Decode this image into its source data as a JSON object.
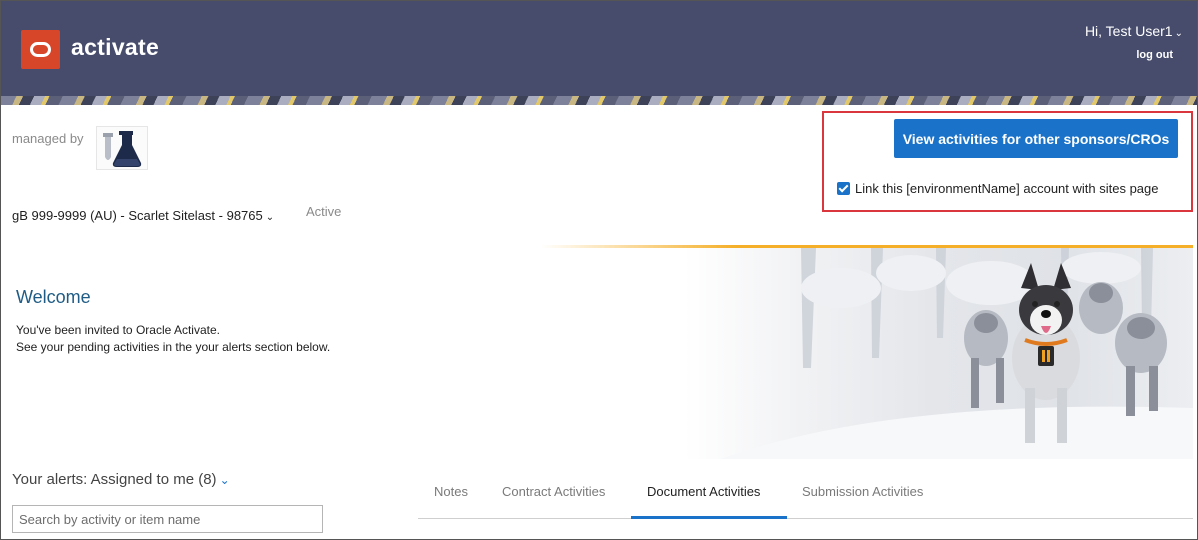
{
  "header": {
    "app_name": "activate",
    "greeting": "Hi, Test User1",
    "logout": "log out",
    "logo_color": "#d8462a",
    "bar_color": "#474c6c"
  },
  "sponsor": {
    "managed_by_label": "managed by",
    "logo_icon": "lab-flask-icon"
  },
  "site": {
    "selected": "gB 999-9999 (AU) - Scarlet Sitelast - 98765",
    "status": "Active"
  },
  "actions": {
    "view_activities_button": "View activities for other sponsors/CROs",
    "link_account_label": "Link this [environmentName] account with sites page",
    "link_account_checked": true,
    "accent_color": "#1a73c8",
    "highlight_color": "#d9363e"
  },
  "welcome": {
    "title": "Welcome",
    "line1": "You've been invited to Oracle Activate.",
    "line2": "See your pending activities in the your alerts section below."
  },
  "alerts": {
    "header": "Your alerts: Assigned to me (8)",
    "search_placeholder": "Search by activity or item name"
  },
  "tabs": [
    {
      "label": "Notes"
    },
    {
      "label": "Contract Activities"
    },
    {
      "label": "Document Activities"
    },
    {
      "label": "Submission Activities"
    }
  ],
  "active_tab": "Document Activities"
}
